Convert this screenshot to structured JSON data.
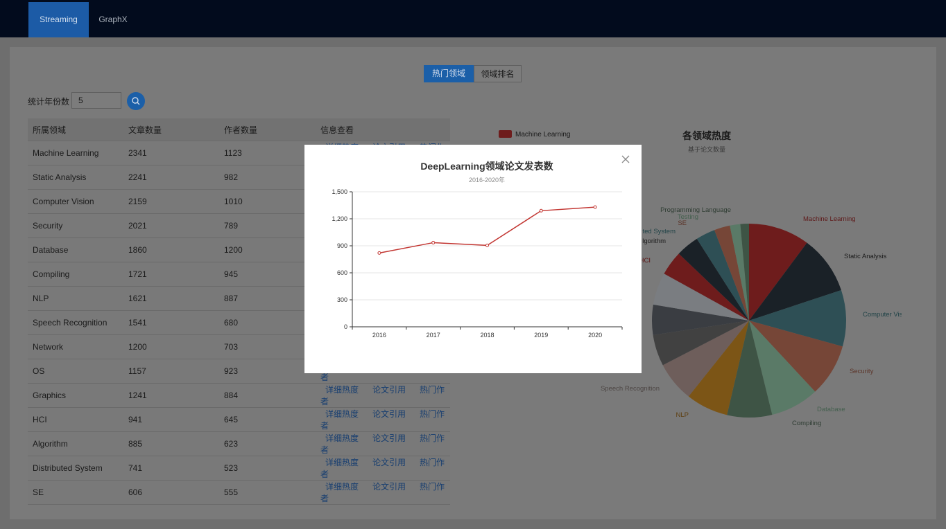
{
  "nav": {
    "tabs": [
      "Streaming",
      "GraphX"
    ],
    "active_tab": "Streaming"
  },
  "toolbar": {
    "seg_hot": "热门领域",
    "seg_rank": "领域排名",
    "year_label": "统计年份数",
    "year_value": "5"
  },
  "table": {
    "headers": [
      "所属领域",
      "文章数量",
      "作者数量",
      "信息查看"
    ],
    "action_labels": [
      "详细热度",
      "论文引用",
      "热门作者"
    ],
    "rows": [
      [
        "Machine Learning",
        "2341",
        "1123"
      ],
      [
        "Static Analysis",
        "2241",
        "982"
      ],
      [
        "Computer Vision",
        "2159",
        "1010"
      ],
      [
        "Security",
        "2021",
        "789"
      ],
      [
        "Database",
        "1860",
        "1200"
      ],
      [
        "Compiling",
        "1721",
        "945"
      ],
      [
        "NLP",
        "1621",
        "887"
      ],
      [
        "Speech Recognition",
        "1541",
        "680"
      ],
      [
        "Network",
        "1200",
        "703"
      ],
      [
        "OS",
        "1157",
        "923"
      ],
      [
        "Graphics",
        "1241",
        "884"
      ],
      [
        "HCI",
        "941",
        "645"
      ],
      [
        "Algorithm",
        "885",
        "623"
      ],
      [
        "Distributed System",
        "741",
        "523"
      ],
      [
        "SE",
        "606",
        "555"
      ]
    ]
  },
  "pie_panel": {
    "title": "各领域热度",
    "subtitle": "基于论文数量",
    "legend_first": "Machine Learning",
    "chart_data": {
      "type": "pie",
      "labels": [
        "Machine Learning",
        "Static Analysis",
        "Computer Vision",
        "Security",
        "Database",
        "Compiling",
        "NLP",
        "Speech Recognition",
        "Network",
        "OS",
        "Graphics",
        "HCI",
        "Algorithm",
        "Distributed System",
        "SE",
        "Testing",
        "Programming Language"
      ],
      "values": [
        2341,
        2241,
        2159,
        2021,
        1860,
        1721,
        1621,
        1541,
        1200,
        1157,
        1241,
        941,
        885,
        741,
        606,
        400,
        330
      ],
      "colors": [
        "#6e1c1c",
        "#1a2127",
        "#2e4f55",
        "#764637",
        "#5a7a67",
        "#3e5445",
        "#7c5516",
        "#6e5e5b",
        "#414141",
        "#3a3d42",
        "#7a7d81",
        "#6e1c1c",
        "#1a2127",
        "#2e4f55",
        "#764637",
        "#5a7a67",
        "#3e5445"
      ],
      "outer_labels": [
        "Machine Learning",
        "Static Analysis",
        "Computer Vision",
        "Security",
        "Database",
        "Compiling",
        "NLP",
        "Speech Recognition",
        "HCI",
        "lgorithm",
        "ted System",
        "SE",
        "Testing",
        "Programming Language"
      ]
    }
  },
  "modal": {
    "title": "DeepLearning领域论文发表数",
    "subtitle": "2016-2020年",
    "chart_data": {
      "type": "line",
      "categories": [
        "2016",
        "2017",
        "2018",
        "2019",
        "2020"
      ],
      "values": [
        820,
        935,
        905,
        1290,
        1330
      ],
      "ylim": [
        0,
        1500
      ],
      "yticks": [
        "0",
        "300",
        "600",
        "900",
        "1,200",
        "1,500"
      ],
      "color": "#c23531",
      "grid": true
    }
  }
}
